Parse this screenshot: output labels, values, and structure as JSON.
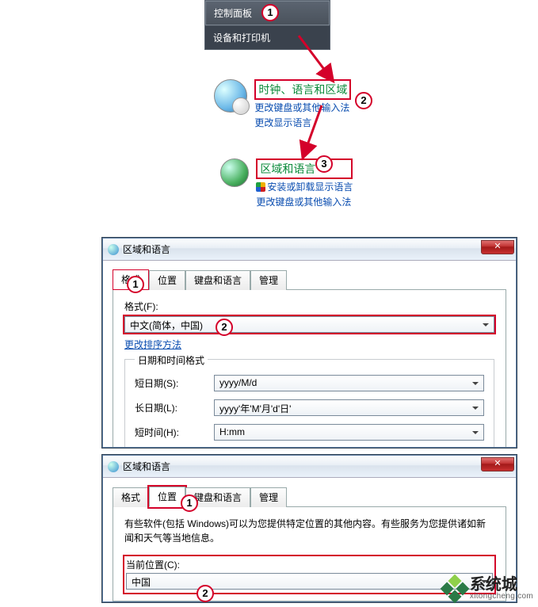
{
  "start_menu": {
    "control_panel": "控制面板",
    "devices_printers": "设备和打印机"
  },
  "cp_category": {
    "clock_heading": "时钟、语言和区域",
    "clock_link1": "更改键盘或其他输入法",
    "clock_link2": "更改显示语言",
    "region_heading": "区域和语言",
    "region_link1": "安装或卸载显示语言",
    "region_link2": "更改键盘或其他输入法"
  },
  "dialog1": {
    "title": "区域和语言",
    "tabs": {
      "format": "格式",
      "location": "位置",
      "keyboard": "键盘和语言",
      "admin": "管理"
    },
    "format_label": "格式(F):",
    "format_value": "中文(简体，中国)",
    "change_sort": "更改排序方法",
    "dt_legend": "日期和时间格式",
    "short_date_label": "短日期(S):",
    "short_date_value": "yyyy/M/d",
    "long_date_label": "长日期(L):",
    "long_date_value": "yyyy'年'M'月'd'日'",
    "short_time_label": "短时间(H):",
    "short_time_value": "H:mm"
  },
  "dialog2": {
    "title": "区域和语言",
    "tabs": {
      "format": "格式",
      "location": "位置",
      "keyboard": "键盘和语言",
      "admin": "管理"
    },
    "desc": "有些软件(包括 Windows)可以为您提供特定位置的其他内容。有些服务为您提供诸如新闻和天气等当地信息。",
    "current_location_label": "当前位置(C):",
    "current_location_value": "中国"
  },
  "badges": {
    "b1": "1",
    "b2": "2",
    "b3": "3"
  },
  "watermark": {
    "brand": "系统城",
    "url": "xitongcheng.com"
  },
  "close_glyph": "✕"
}
